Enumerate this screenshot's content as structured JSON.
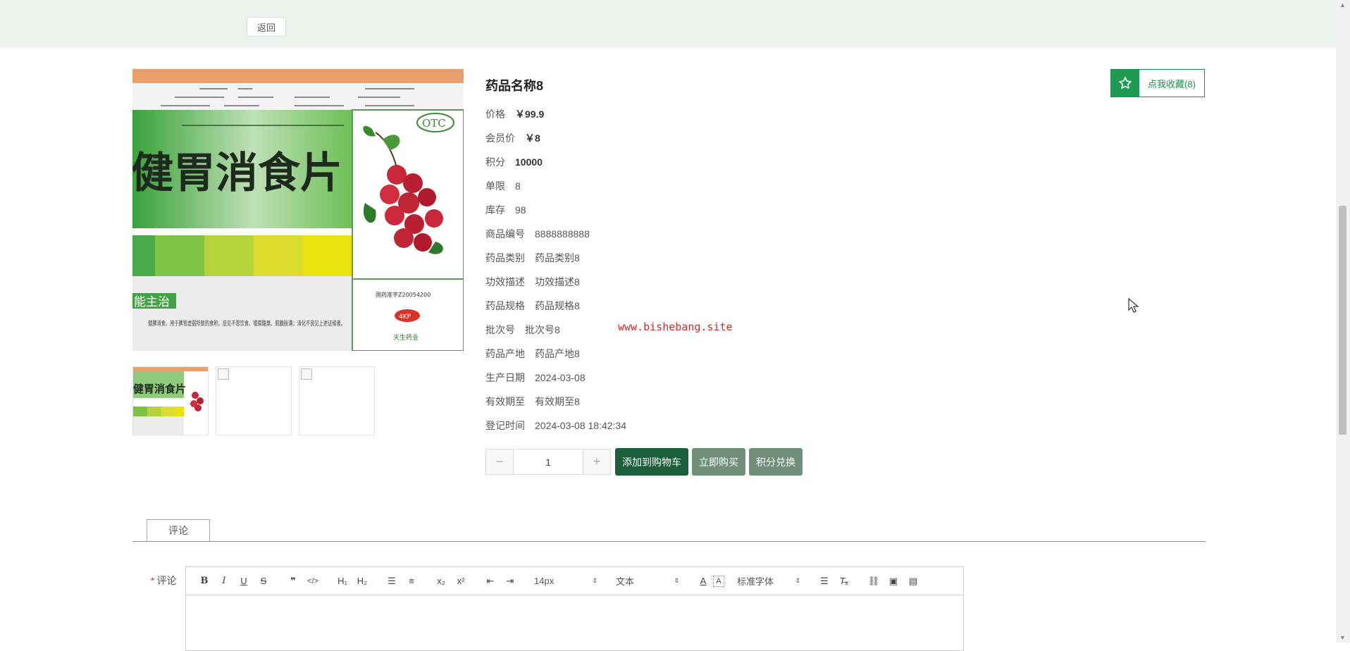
{
  "topbar": {
    "back_label": "返回"
  },
  "product": {
    "title": "药品名称8",
    "image": {
      "package_text": "健胃消食片",
      "badge": "OTC",
      "section_label": "能主治",
      "approval": "国药准字Z20054200",
      "brand_label": "4KP",
      "company": "天生药业",
      "description": "健脾消食。用于脾胃虚弱所致的食积，症见不思饮食、嗳腐酸臭、脘腹胀满；消化不良见上述证候者。"
    },
    "fields": [
      {
        "label": "价格",
        "value": "￥99.9",
        "bold": true
      },
      {
        "label": "会员价",
        "value": "￥8",
        "bold": true
      },
      {
        "label": "积分",
        "value": "10000",
        "bold": true
      },
      {
        "label": "单限",
        "value": "8"
      },
      {
        "label": "库存",
        "value": "98"
      },
      {
        "label": "商品编号",
        "value": "8888888888"
      },
      {
        "label": "药品类别",
        "value": "药品类别8"
      },
      {
        "label": "功效描述",
        "value": "功效描述8"
      },
      {
        "label": "药品规格",
        "value": "药品规格8"
      },
      {
        "label": "批次号",
        "value": "批次号8"
      },
      {
        "label": "药品产地",
        "value": "药品产地8"
      },
      {
        "label": "生产日期",
        "value": "2024-03-08"
      },
      {
        "label": "有效期至",
        "value": "有效期至8"
      },
      {
        "label": "登记时间",
        "value": "2024-03-08 18:42:34"
      }
    ],
    "favorite_label": "点我收藏(8)",
    "quantity": "1",
    "quantity_minus": "−",
    "quantity_plus": "+",
    "add_to_cart_label": "添加到购物车",
    "buy_now_label": "立即购买",
    "points_exchange_label": "积分兑换",
    "watermark": "www.bishebang.site"
  },
  "comments": {
    "tab_label": "评论",
    "field_required_mark": "*",
    "field_label": "评论",
    "toolbar": {
      "font_size": "14px",
      "header_select": "文本",
      "font_family": "标准字体"
    }
  },
  "colors": {
    "accent": "#1e9a52",
    "cart": "#1b5e3a",
    "secondary": "#6f8f78"
  }
}
